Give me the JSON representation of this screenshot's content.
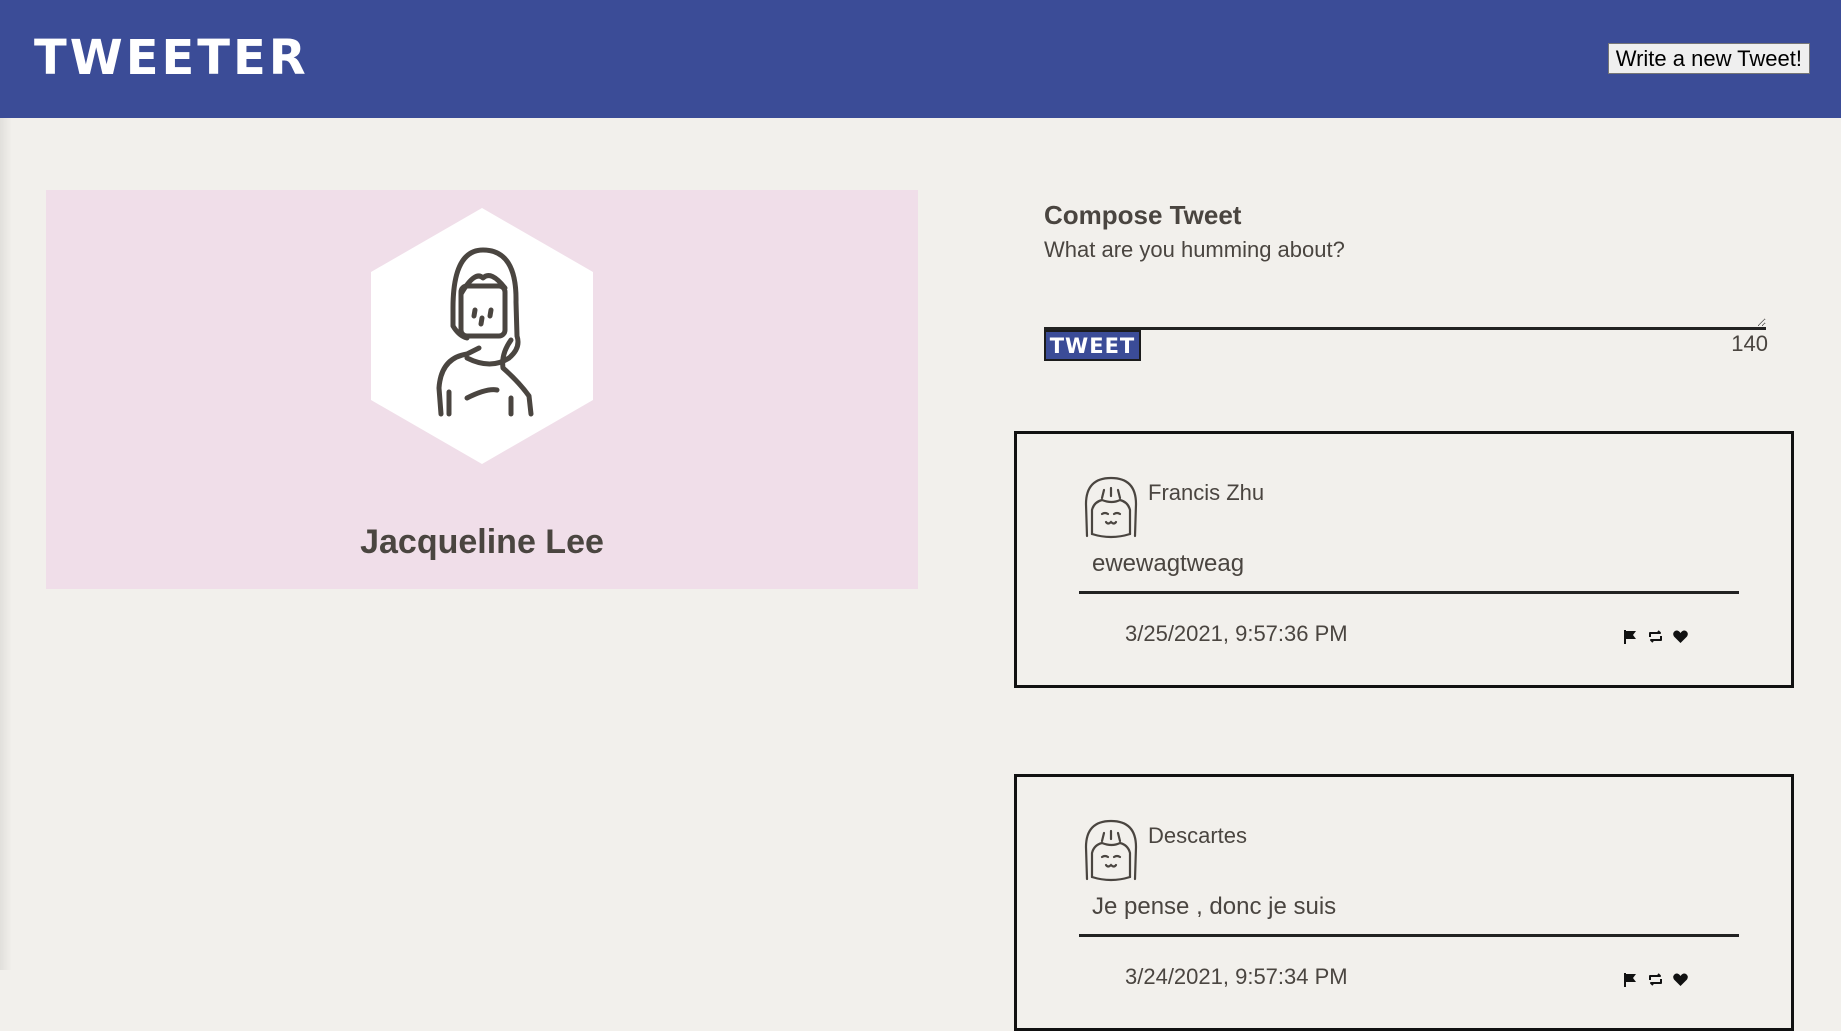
{
  "app": {
    "logo": "TWEETER",
    "new_tweet_button": "Write a new Tweet!"
  },
  "profile": {
    "name": "Jacqueline Lee"
  },
  "compose": {
    "title": "Compose Tweet",
    "placeholder": "What are you humming about?",
    "button": "TWEET",
    "counter": "140"
  },
  "tweets": [
    {
      "author": "Francis Zhu",
      "content": "ewewagtweag",
      "date": "3/25/2021, 9:57:36 PM",
      "icons": [
        "flag-icon",
        "retweet-icon",
        "heart-icon"
      ]
    },
    {
      "author": "Descartes",
      "content": "Je pense , donc je suis",
      "date": "3/24/2021, 9:57:34 PM",
      "icons": [
        "flag-icon",
        "retweet-icon",
        "heart-icon"
      ]
    }
  ]
}
